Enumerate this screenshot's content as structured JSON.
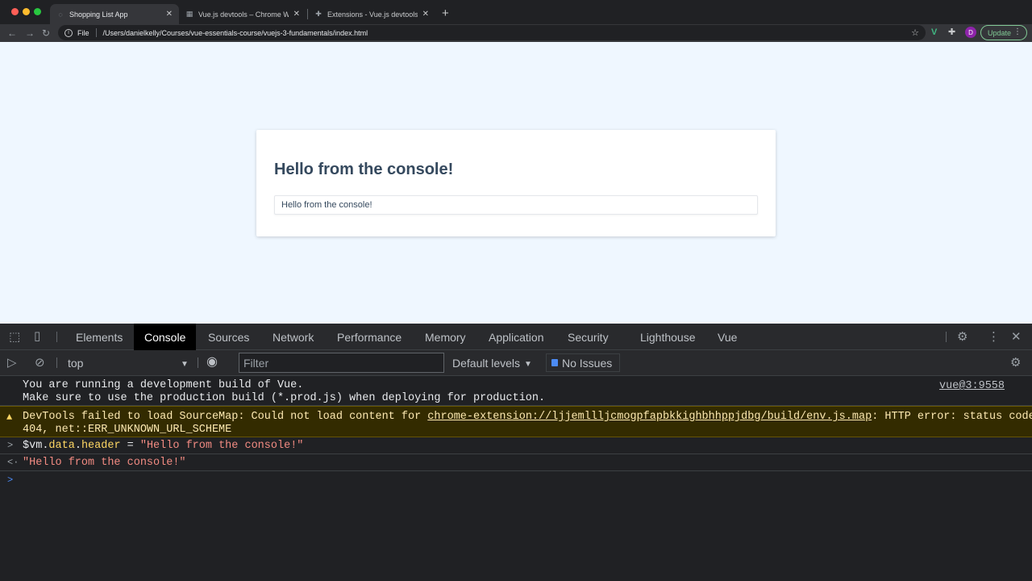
{
  "browser": {
    "tabs": [
      {
        "title": "Shopping List App",
        "active": true
      },
      {
        "title": "Vue.js devtools – Chrome Web",
        "active": false
      },
      {
        "title": "Extensions - Vue.js devtools",
        "active": false
      }
    ],
    "new_tab": "+",
    "close_glyph": "✕",
    "url_scheme": "File",
    "url": "/Users/danielkelly/Courses/vue-essentials-course/vuejs-3-fundamentals/index.html",
    "avatar_initial": "D",
    "update_label": "Update"
  },
  "page": {
    "header": "Hello from the console!",
    "input_value": "Hello from the console!"
  },
  "devtools": {
    "tabs": [
      "Elements",
      "Console",
      "Sources",
      "Network",
      "Performance",
      "Memory",
      "Application",
      "Security",
      "Lighthouse",
      "Vue"
    ],
    "active_tab": "Console",
    "context": "top",
    "filter_placeholder": "Filter",
    "levels": "Default levels",
    "issues": "No Issues",
    "console": {
      "info_line1": "You are running a development build of Vue.",
      "info_line2": "Make sure to use the production build (*.prod.js) when deploying for production.",
      "info_source": "vue@3:9558",
      "warn_prefix": "DevTools failed to load SourceMap: Could not load content for ",
      "warn_link": "chrome-extension://ljjemllljcmogpfapbkkighbhhppjdbg/build/env.js.map",
      "warn_suffix": ": HTTP error: status code",
      "warn_line2": "404, net::ERR_UNKNOWN_URL_SCHEME",
      "cmd_var": "$vm",
      "cmd_prop1": "data",
      "cmd_prop2": "header",
      "cmd_string": "\"Hello from the console!\"",
      "result": "\"Hello from the console!\""
    }
  }
}
